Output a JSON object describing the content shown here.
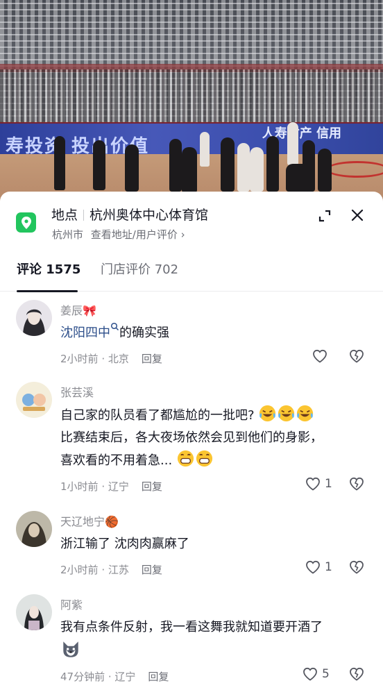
{
  "location": {
    "label": "地点",
    "venue": "杭州奥体中心体育馆",
    "city": "杭州市",
    "sub_link": "查看地址/用户评价 ›"
  },
  "banner": {
    "left_text": "寿投资  投出价值",
    "right_text": "人寿财产  信用"
  },
  "tabs": [
    {
      "label": "评论 1575",
      "active": true
    },
    {
      "label": "门店评价 702",
      "active": false
    }
  ],
  "comments": [
    {
      "user": "姜辰🎀",
      "mention": "沈阳四中",
      "text": "的确实强",
      "time": "2小时前",
      "region": "北京",
      "reply": "回复",
      "likes": ""
    },
    {
      "user": "张芸溪",
      "text_lines": [
        "自己家的队员看了都尴尬的一批吧?",
        "比赛结束后，各大夜场依然会见到他们的身影，",
        "喜欢看的不用着急..."
      ],
      "time": "1小时前",
      "region": "辽宁",
      "reply": "回复",
      "likes": "1"
    },
    {
      "user": "天辽地宁🏀",
      "text": "浙江输了  沈肉肉赢麻了",
      "time": "2小时前",
      "region": "江苏",
      "reply": "回复",
      "likes": "1"
    },
    {
      "user": "阿紫",
      "text": "我有点条件反射，我一看这舞我就知道要开酒了",
      "time": "47分钟前",
      "region": "辽宁",
      "reply": "回复",
      "likes": "5"
    }
  ],
  "colors": {
    "location_icon": "#22c55e",
    "mention": "#2c4e8a",
    "text_primary": "#161823",
    "text_secondary": "#8a8b91"
  }
}
